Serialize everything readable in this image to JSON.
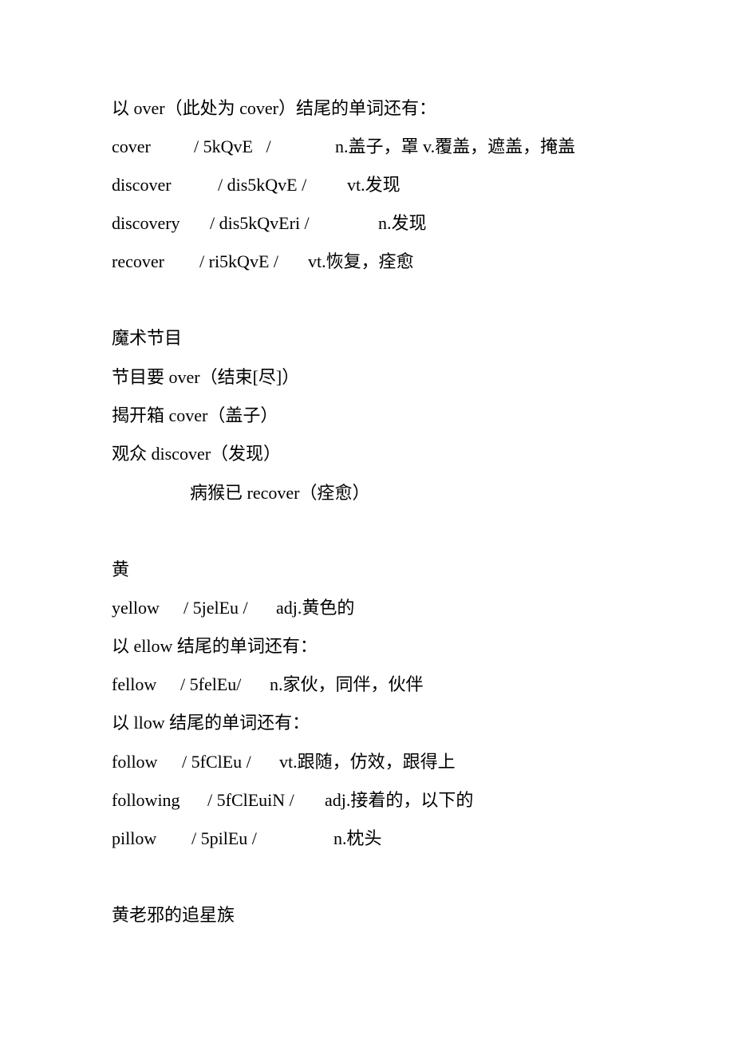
{
  "section1": {
    "intro": "以 over（此处为 cover）结尾的单词还有：",
    "entries": [
      {
        "word": "cover",
        "phonetic": "/ 5kQvE   /",
        "meaning": "n.盖子，罩 v.覆盖，遮盖，掩盖"
      },
      {
        "word": "discover",
        "phonetic": "/ dis5kQvE /",
        "meaning": "vt.发现"
      },
      {
        "word": "discovery",
        "phonetic": "/ dis5kQvEri /",
        "meaning": "n.发现"
      },
      {
        "word": "recover",
        "phonetic": "/ ri5kQvE /",
        "meaning": "vt.恢复，痊愈"
      }
    ]
  },
  "section2": {
    "title": "魔术节目",
    "lines": [
      "节目要 over（结束[尽]）",
      "揭开箱 cover（盖子）",
      "观众 discover（发现）",
      "病猴已 recover（痊愈）"
    ]
  },
  "section3": {
    "title": "黄",
    "yellow": {
      "word": "yellow",
      "phonetic": "/ 5jelEu /",
      "meaning": "adj.黄色的"
    },
    "intro_ellow": "以 ellow 结尾的单词还有：",
    "fellow": {
      "word": "fellow",
      "phonetic": "/ 5felEu/",
      "meaning": "n.家伙，同伴，伙伴"
    },
    "intro_llow": "以 llow 结尾的单词还有：",
    "entries": [
      {
        "word": "follow",
        "phonetic": "/ 5fClEu /",
        "meaning": "vt.跟随，仿效，跟得上"
      },
      {
        "word": "following",
        "phonetic": "/ 5fClEuiN /",
        "meaning": "adj.接着的，以下的"
      },
      {
        "word": "pillow",
        "phonetic": "/ 5pilEu /",
        "meaning": "n.枕头"
      }
    ]
  },
  "section4": {
    "title": "黄老邪的追星族"
  }
}
